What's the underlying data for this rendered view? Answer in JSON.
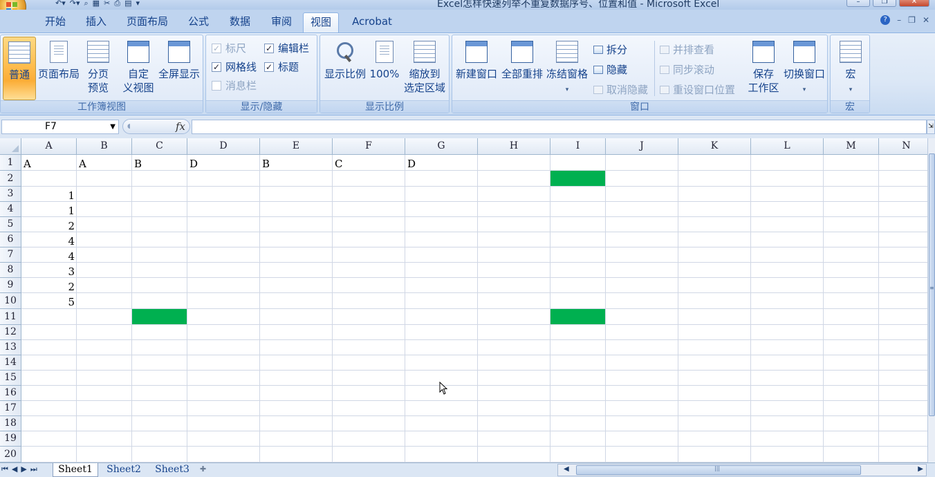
{
  "window": {
    "title": "Excel怎样快速列举不重复数据序号、位置和值 - Microsoft Excel"
  },
  "tabs": [
    {
      "label": "开始",
      "active": false
    },
    {
      "label": "插入",
      "active": false
    },
    {
      "label": "页面布局",
      "active": false
    },
    {
      "label": "公式",
      "active": false
    },
    {
      "label": "数据",
      "active": false
    },
    {
      "label": "审阅",
      "active": false
    },
    {
      "label": "视图",
      "active": true
    },
    {
      "label": "Acrobat",
      "active": false
    }
  ],
  "ribbon": {
    "workbook_views": {
      "label": "工作簿视图",
      "normal": "普通",
      "page_layout": "页面布局",
      "page_break_1": "分页",
      "page_break_2": "预览",
      "custom_1": "自定",
      "custom_2": "义视图",
      "fullscreen": "全屏显示"
    },
    "show_hide": {
      "label": "显示/隐藏",
      "ruler": "标尺",
      "gridlines": "网格线",
      "message_bar": "消息栏",
      "formula_bar": "编辑栏",
      "headings": "标题"
    },
    "zoom": {
      "label": "显示比例",
      "zoom": "显示比例",
      "hundred": "100%",
      "to_sel_1": "缩放到",
      "to_sel_2": "选定区域"
    },
    "window": {
      "label": "窗口",
      "new_window": "新建窗口",
      "arrange_all": "全部重排",
      "freeze": "冻结窗格",
      "split": "拆分",
      "hide": "隐藏",
      "unhide": "取消隐藏",
      "side_by_side": "并排查看",
      "sync_scroll": "同步滚动",
      "reset_pos": "重设窗口位置",
      "save_ws_1": "保存",
      "save_ws_2": "工作区",
      "switch": "切换窗口"
    },
    "macros": {
      "label": "宏",
      "macros": "宏"
    }
  },
  "formula_bar": {
    "name_box": "F7",
    "fx": "fx",
    "content": ""
  },
  "columns": [
    "A",
    "B",
    "C",
    "D",
    "E",
    "F",
    "G",
    "H",
    "I",
    "J",
    "K",
    "L",
    "M",
    "N"
  ],
  "rows": [
    "1",
    "2",
    "3",
    "4",
    "5",
    "6",
    "7",
    "8",
    "9",
    "10",
    "11",
    "12",
    "13",
    "14",
    "15",
    "16",
    "17",
    "18",
    "19",
    "20"
  ],
  "cells": {
    "A1": "A",
    "B1": "A",
    "C1": "B",
    "D1": "D",
    "E1": "B",
    "F1": "C",
    "G1": "D",
    "A3": "1",
    "A4": "1",
    "A5": "2",
    "A6": "4",
    "A7": "4",
    "A8": "3",
    "A9": "2",
    "A10": "5"
  },
  "fill_color": "#00b050",
  "sheets": [
    "Sheet1",
    "Sheet2",
    "Sheet3"
  ],
  "active_sheet": "Sheet1"
}
